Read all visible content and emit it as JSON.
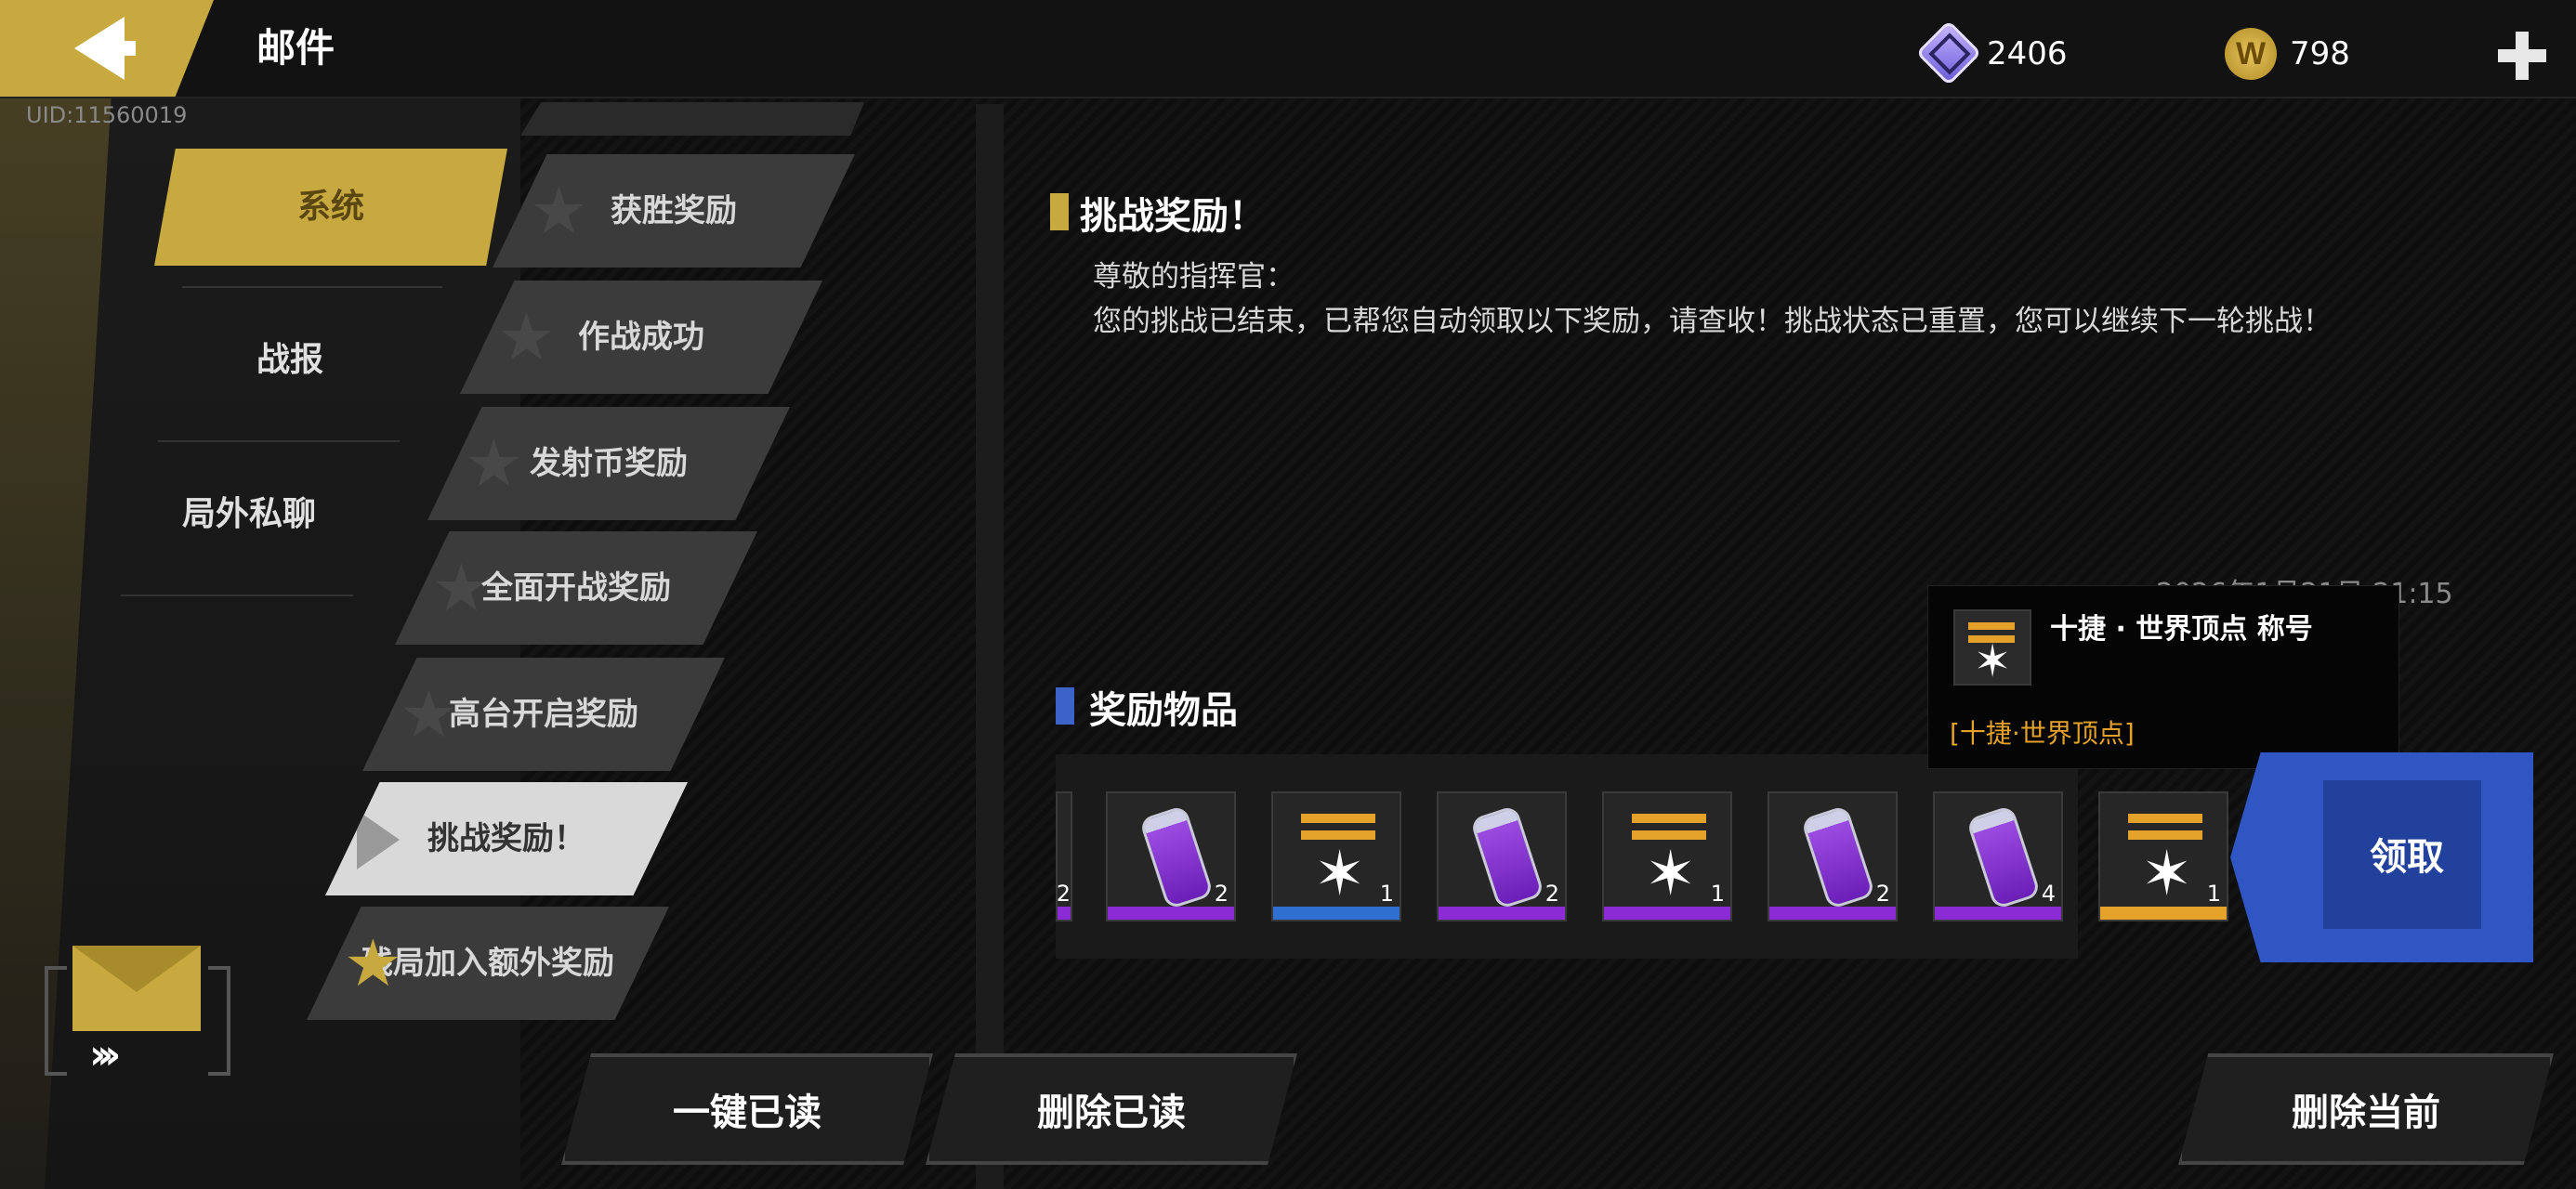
{
  "header": {
    "title": "邮件",
    "uid": "UID:11560019",
    "currency_gem": "2406",
    "currency_coin": "798",
    "coin_letter": "W"
  },
  "categories": [
    {
      "label": "系统"
    },
    {
      "label": "战报"
    },
    {
      "label": "局外私聊"
    }
  ],
  "mails": [
    {
      "label": "获胜奖励"
    },
    {
      "label": "作战成功"
    },
    {
      "label": "发射币奖励"
    },
    {
      "label": "全面开战奖励"
    },
    {
      "label": "高台开启奖励"
    },
    {
      "label": "挑战奖励！"
    },
    {
      "label": "残局加入额外奖励"
    }
  ],
  "message": {
    "title": "挑战奖励！",
    "greeting": "尊敬的指挥官：",
    "body": "您的挑战已结束，已帮您自动领取以下奖励，请查收！挑战状态已重置，您可以继续下一轮挑战！",
    "date": "2026年1月21日 21:15",
    "date_tail": "月"
  },
  "rewards": {
    "title": "奖励物品",
    "partial_count": "2",
    "items": [
      {
        "type": "vial",
        "count": "2",
        "color": "#8a2bd6"
      },
      {
        "type": "medal",
        "count": "1",
        "color": "#2f6fd0"
      },
      {
        "type": "vial",
        "count": "2",
        "color": "#8a2bd6"
      },
      {
        "type": "medal",
        "count": "1",
        "color": "#8a2bd6"
      },
      {
        "type": "vial",
        "count": "2",
        "color": "#8a2bd6"
      },
      {
        "type": "vial",
        "count": "4",
        "color": "#8a2bd6"
      },
      {
        "type": "medal",
        "count": "1",
        "color": "#e5a22a"
      }
    ]
  },
  "tooltip": {
    "name": "十捷 · 世界顶点 称号",
    "subtitle": "[十捷·世界顶点]"
  },
  "actions": {
    "claim": "领取",
    "read_all": "一键已读",
    "delete_read": "删除已读",
    "delete_current": "删除当前"
  },
  "colors": {
    "gold": "#c7a93f",
    "blue": "#2f56c2",
    "orange": "#e5a22a",
    "purple": "#8a2bd6"
  }
}
